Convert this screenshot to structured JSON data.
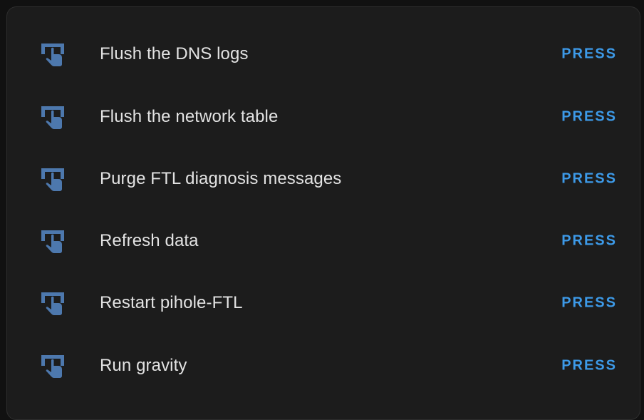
{
  "colors": {
    "background": "#1c1c1c",
    "text": "#e3e3e3",
    "accent": "#3d9ae8",
    "icon": "#4d78ad"
  },
  "rows": [
    {
      "label": "Flush the DNS logs",
      "action": "PRESS",
      "icon": "gesture-tap-button-icon"
    },
    {
      "label": "Flush the network table",
      "action": "PRESS",
      "icon": "gesture-tap-button-icon"
    },
    {
      "label": "Purge FTL diagnosis messages",
      "action": "PRESS",
      "icon": "gesture-tap-button-icon"
    },
    {
      "label": "Refresh data",
      "action": "PRESS",
      "icon": "gesture-tap-button-icon"
    },
    {
      "label": "Restart pihole-FTL",
      "action": "PRESS",
      "icon": "gesture-tap-button-icon"
    },
    {
      "label": "Run gravity",
      "action": "PRESS",
      "icon": "gesture-tap-button-icon"
    }
  ]
}
